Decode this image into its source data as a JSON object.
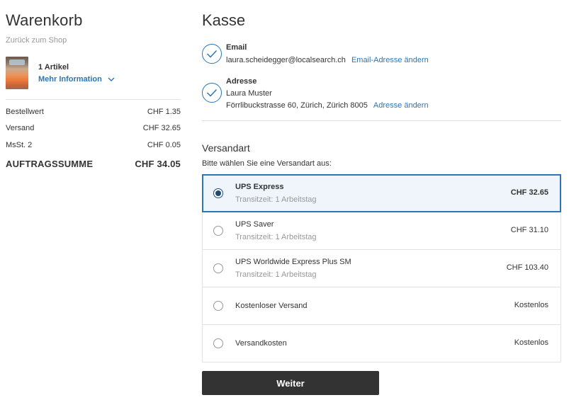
{
  "cart": {
    "title": "Warenkorb",
    "back_link": "Zurück zum Shop",
    "item_count": "1 Artikel",
    "more_info": "Mehr Information",
    "summary": [
      {
        "label": "Bestellwert",
        "value": "CHF 1.35"
      },
      {
        "label": "Versand",
        "value": "CHF 32.65"
      },
      {
        "label": "MsSt. 2",
        "value": "CHF 0.05"
      }
    ],
    "total": {
      "label": "AUFTRAGSSUMME",
      "value": "CHF 34.05"
    }
  },
  "checkout": {
    "title": "Kasse",
    "email": {
      "label": "Email",
      "value": "laura.scheidegger@localsearch.ch",
      "change_link": "Email-Adresse ändern"
    },
    "address": {
      "label": "Adresse",
      "name": "Laura Muster",
      "street": "Förrlibuckstrasse 60, Zürich, Zürich 8005",
      "change_link": "Adresse ändern"
    },
    "shipping": {
      "title": "Versandart",
      "hint": "Bitte wählen Sie eine Versandart aus:",
      "options": [
        {
          "name": "UPS Express",
          "transit": "Transitzeit: 1 Arbeitstag",
          "price": "CHF 32.65",
          "selected": true
        },
        {
          "name": "UPS Saver",
          "transit": "Transitzeit: 1 Arbeitstag",
          "price": "CHF 31.10",
          "selected": false
        },
        {
          "name": "UPS Worldwide Express Plus SM",
          "transit": "Transitzeit: 1 Arbeitstag",
          "price": "CHF 103.40",
          "selected": false
        },
        {
          "name": "Kostenloser Versand",
          "transit": "",
          "price": "Kostenlos",
          "selected": false
        },
        {
          "name": "Versandkosten",
          "transit": "",
          "price": "Kostenlos",
          "selected": false
        }
      ]
    },
    "continue_button": "Weiter"
  },
  "colors": {
    "accent": "#2a76b8",
    "selected_bg": "#eff5fb",
    "button_bg": "#333333"
  }
}
